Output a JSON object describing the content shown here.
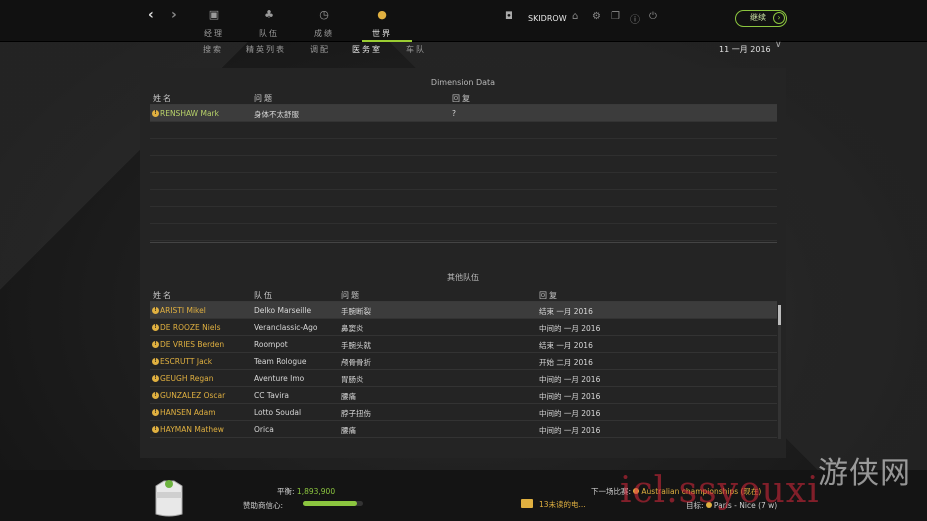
{
  "nav": {
    "back_icon": "chevron-left-icon",
    "forward_icon": "chevron-right-icon",
    "tabs": [
      {
        "label": "经理",
        "icon": "briefcase-icon"
      },
      {
        "label": "队伍",
        "icon": "team-icon"
      },
      {
        "label": "成绩",
        "icon": "stopwatch-icon"
      },
      {
        "label": "世界",
        "icon": "globe-icon"
      }
    ],
    "active_tab": "世界",
    "user": "SKIDROW",
    "continue_label": "继续",
    "accent_color": "#8cc63f"
  },
  "subnav": {
    "items": [
      "搜索",
      "精英列表",
      "调配",
      "医务室",
      "车队"
    ],
    "active": "医务室"
  },
  "date": "11 一月 2016",
  "own_team": {
    "title": "Dimension Data",
    "headers": {
      "name": "姓名",
      "issue": "问题",
      "recovery": "回复"
    },
    "rows": [
      {
        "name": "RENSHAW Mark",
        "issue": "身体不太舒服",
        "recovery": "?"
      }
    ]
  },
  "other_teams": {
    "title": "其他队伍",
    "headers": {
      "name": "姓名",
      "team": "队伍",
      "issue": "问题",
      "recovery": "回复"
    },
    "rows": [
      {
        "name": "ARISTI Mikel",
        "team": "Delko Marseille",
        "issue": "手腕断裂",
        "recovery": "结束 一月 2016"
      },
      {
        "name": "DE ROOZE Niels",
        "team": "Veranclassic-Ago",
        "issue": "鼻窦炎",
        "recovery": "中间的 一月 2016"
      },
      {
        "name": "DE VRIES Berden",
        "team": "Roompot",
        "issue": "手腕头就",
        "recovery": "结束 一月 2016"
      },
      {
        "name": "ESCRUTT Jack",
        "team": "Team Rologue",
        "issue": "颅骨骨折",
        "recovery": "开始 二月 2016"
      },
      {
        "name": "GEUGH Regan",
        "team": "Aventure Imo",
        "issue": "胃肠炎",
        "recovery": "中间的 一月 2016"
      },
      {
        "name": "GUNZALEZ Oscar",
        "team": "CC Tavira",
        "issue": "腰痛",
        "recovery": "中间的 一月 2016"
      },
      {
        "name": "HANSEN Adam",
        "team": "Lotto Soudal",
        "issue": "脖子扭伤",
        "recovery": "中间的 一月 2016"
      },
      {
        "name": "HAYMAN Mathew",
        "team": "Orica",
        "issue": "腰痛",
        "recovery": "中间的 一月 2016"
      }
    ]
  },
  "footer": {
    "balance_label": "平衡:",
    "balance_value": "1,893,900",
    "sponsor_label": "赞助商信心:",
    "sponsor_confidence": 0.9,
    "mail_text": "13未读的电...",
    "next_race_label": "下一场比赛:",
    "next_race_value": "Australian championships (现在)",
    "goal_label": "目标:",
    "goal_value": "Paris - Nice (7 w)"
  },
  "watermark": {
    "text": "icl.ssyouxi",
    "logo_text": "游侠网"
  }
}
